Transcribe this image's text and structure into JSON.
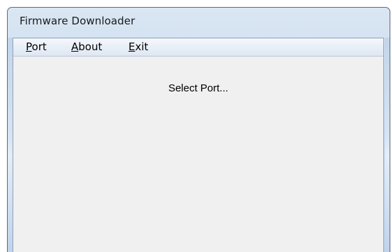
{
  "window": {
    "title": "Firmware Downloader"
  },
  "menubar": {
    "items": [
      {
        "mnemonic": "P",
        "rest": "ort"
      },
      {
        "mnemonic": "A",
        "rest": "bout"
      },
      {
        "mnemonic": "E",
        "rest": "xit"
      }
    ]
  },
  "main": {
    "status_text": "Select Port..."
  }
}
